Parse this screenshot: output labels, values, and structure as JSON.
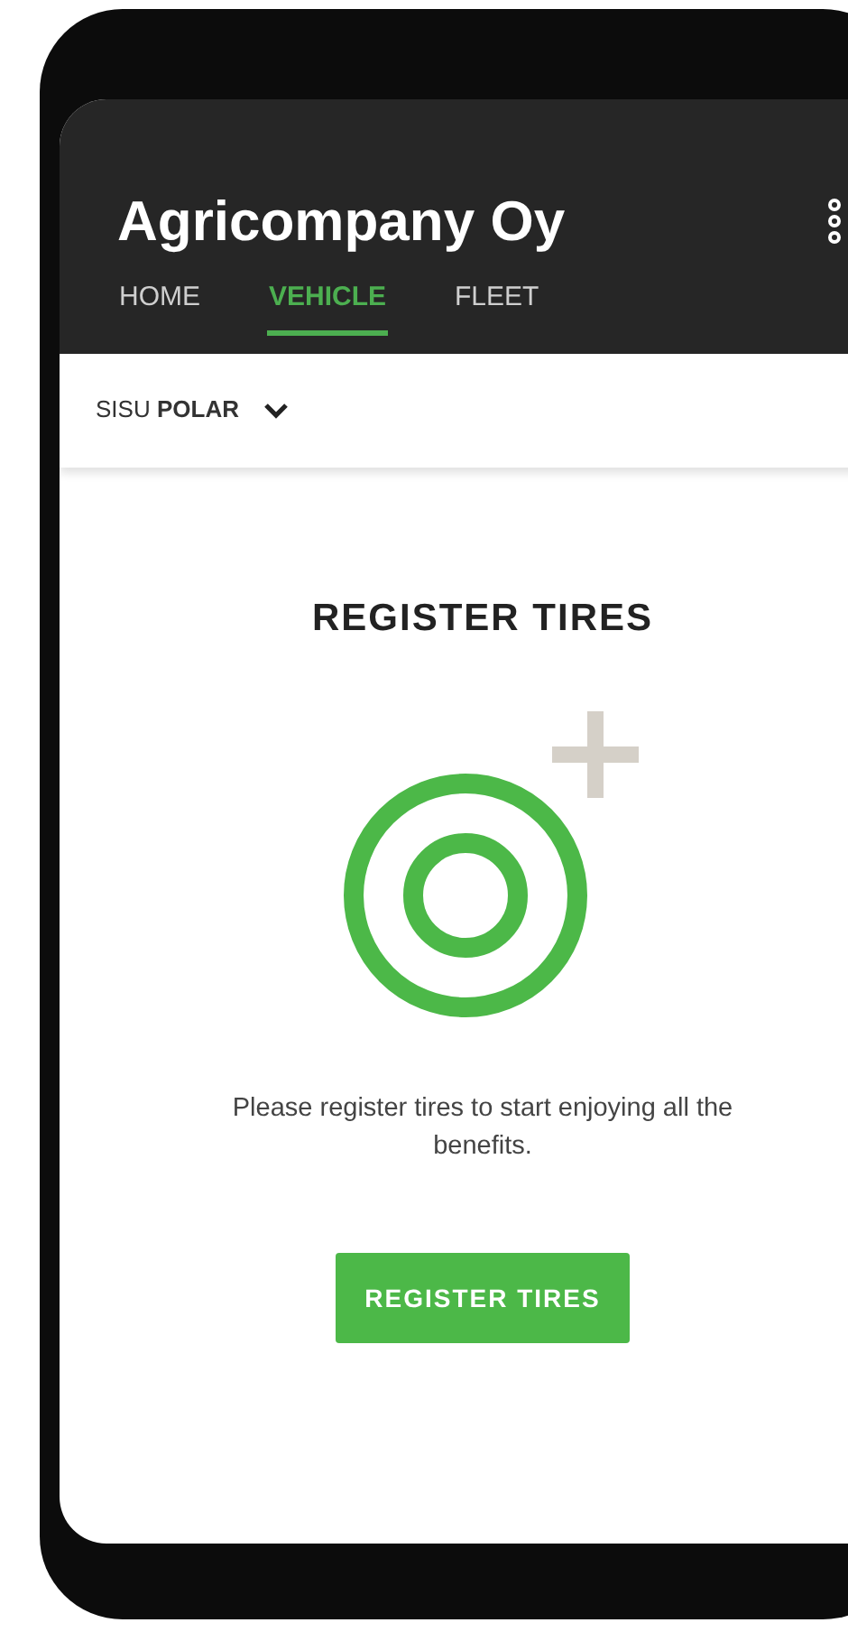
{
  "header": {
    "title": "Agricompany Oy"
  },
  "tabs": [
    {
      "label": "HOME",
      "selected": false
    },
    {
      "label": "VEHICLE",
      "selected": true
    },
    {
      "label": "FLEET",
      "selected": false
    }
  ],
  "vehicle_selector": {
    "value": "SISU **POLAR**"
  },
  "content": {
    "title": "REGISTER TIRES",
    "message": "Please register tires to start enjoying all the benefits.",
    "button": "REGISTER TIRES"
  }
}
